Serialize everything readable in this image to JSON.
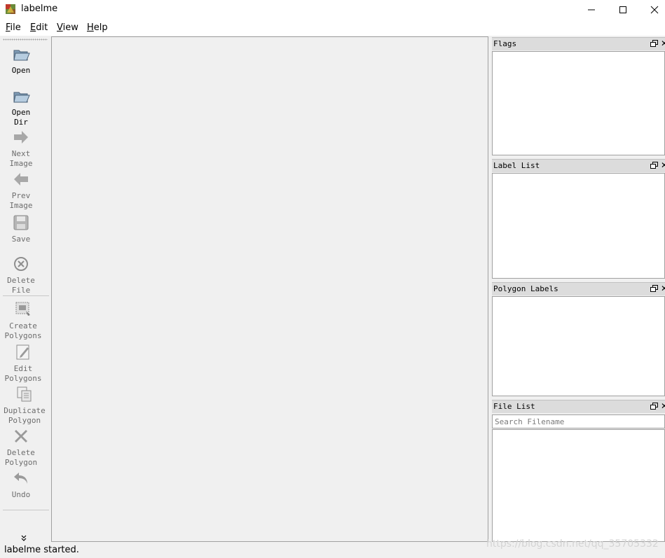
{
  "window": {
    "title": "labelme",
    "icon": "labelme-app-icon",
    "controls": [
      "minimize-icon",
      "maximize-icon",
      "close-icon"
    ]
  },
  "menu": {
    "file": "File",
    "edit": "Edit",
    "view": "View",
    "help": "Help"
  },
  "toolbar": {
    "open": "Open",
    "open_dir": "Open\nDir",
    "next_image": "Next\nImage",
    "prev_image": "Prev\nImage",
    "save": "Save",
    "delete_file": "Delete\nFile",
    "create_polygons": "Create\nPolygons",
    "edit_polygons": "Edit\nPolygons",
    "duplicate_polygon": "Duplicate\nPolygon",
    "delete_polygon": "Delete\nPolygon",
    "undo": "Undo",
    "more": "»"
  },
  "docks": {
    "flags": "Flags",
    "label_list": "Label List",
    "polygon_labels": "Polygon Labels",
    "file_list": "File List",
    "close_glyph": "✕"
  },
  "file_search": {
    "placeholder": "Search Filename",
    "value": ""
  },
  "status": {
    "message": "labelme started."
  },
  "watermark": "https://blog.csdn.net/qq_35705332",
  "colors": {
    "window_bg": "#f0f0f0",
    "panel_bg": "#ffffff",
    "dock_header": "#dcdcdc",
    "border": "#a0a0a0",
    "disabled_text": "#6d6d6d"
  }
}
